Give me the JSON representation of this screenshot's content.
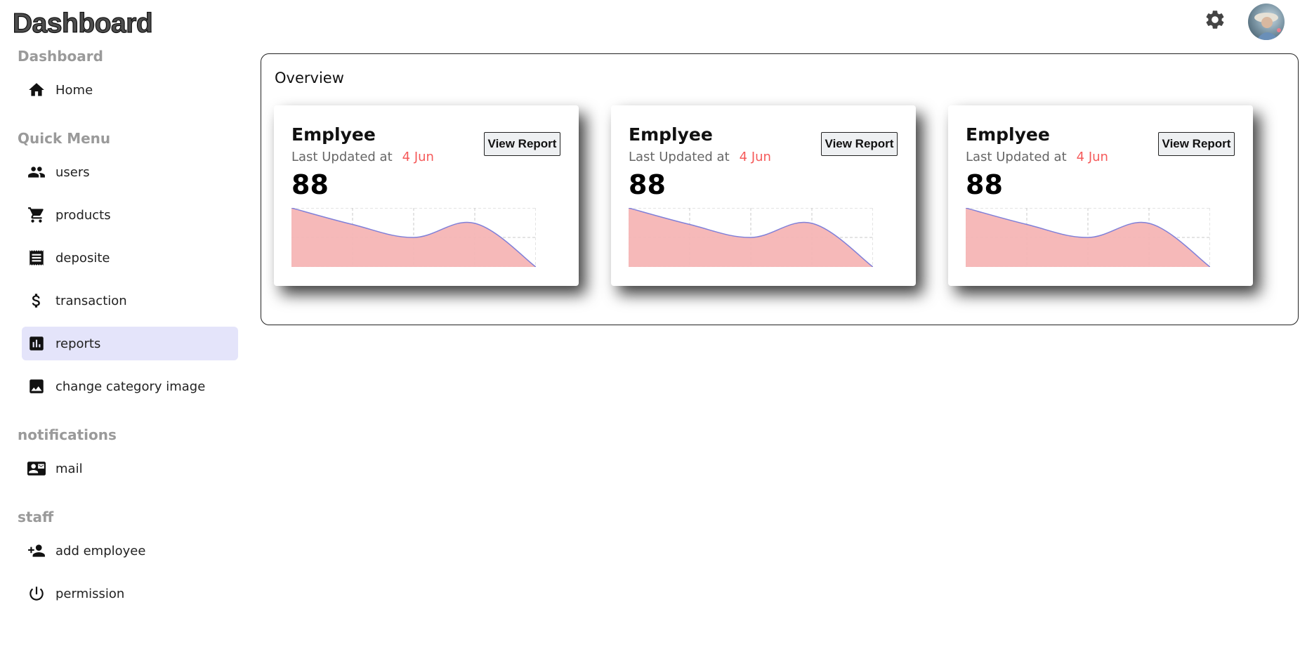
{
  "header": {
    "logo_text": "Dashboard",
    "settings_icon": "gear-icon",
    "avatar_icon": "user-avatar"
  },
  "sidebar": {
    "sections": [
      {
        "title": "Dashboard",
        "items": [
          {
            "label": "Home",
            "icon": "home-icon",
            "active": false
          }
        ]
      },
      {
        "title": "Quick Menu",
        "items": [
          {
            "label": "users",
            "icon": "users-icon",
            "active": false
          },
          {
            "label": "products",
            "icon": "cart-icon",
            "active": false
          },
          {
            "label": "deposite",
            "icon": "receipt-icon",
            "active": false
          },
          {
            "label": "transaction",
            "icon": "dollar-icon",
            "active": false
          },
          {
            "label": "reports",
            "icon": "bar-chart-icon",
            "active": true
          },
          {
            "label": "change category image",
            "icon": "image-icon",
            "active": false
          }
        ]
      },
      {
        "title": "notifications",
        "items": [
          {
            "label": "mail",
            "icon": "contact-mail-icon",
            "active": false
          }
        ]
      },
      {
        "title": "staff",
        "items": [
          {
            "label": "add employee",
            "icon": "person-add-icon",
            "active": false
          },
          {
            "label": "permission",
            "icon": "power-icon",
            "active": false
          }
        ]
      }
    ]
  },
  "overview": {
    "title": "Overview",
    "cards": [
      {
        "title": "Emplyee",
        "sub_label": "Last Updated at",
        "date": "4 Jun",
        "value": "88",
        "button_label": "View Report"
      },
      {
        "title": "Emplyee",
        "sub_label": "Last Updated at",
        "date": "4 Jun",
        "value": "88",
        "button_label": "View Report"
      },
      {
        "title": "Emplyee",
        "sub_label": "Last Updated at",
        "date": "4 Jun",
        "value": "88",
        "button_label": "View Report"
      }
    ]
  },
  "colors": {
    "active_item_bg": "#e4e4fa",
    "date_accent": "#f55a5a",
    "area_fill": "#f5b5b5",
    "area_stroke": "#8080d8"
  },
  "chart_data": [
    {
      "type": "area",
      "x": [
        0,
        1,
        2,
        3,
        4
      ],
      "values": [
        100,
        72,
        50,
        74,
        0
      ],
      "ylim": [
        0,
        100
      ],
      "grid": true
    },
    {
      "type": "area",
      "x": [
        0,
        1,
        2,
        3,
        4
      ],
      "values": [
        100,
        72,
        50,
        74,
        0
      ],
      "ylim": [
        0,
        100
      ],
      "grid": true
    },
    {
      "type": "area",
      "x": [
        0,
        1,
        2,
        3,
        4
      ],
      "values": [
        100,
        72,
        50,
        74,
        0
      ],
      "ylim": [
        0,
        100
      ],
      "grid": true
    }
  ]
}
